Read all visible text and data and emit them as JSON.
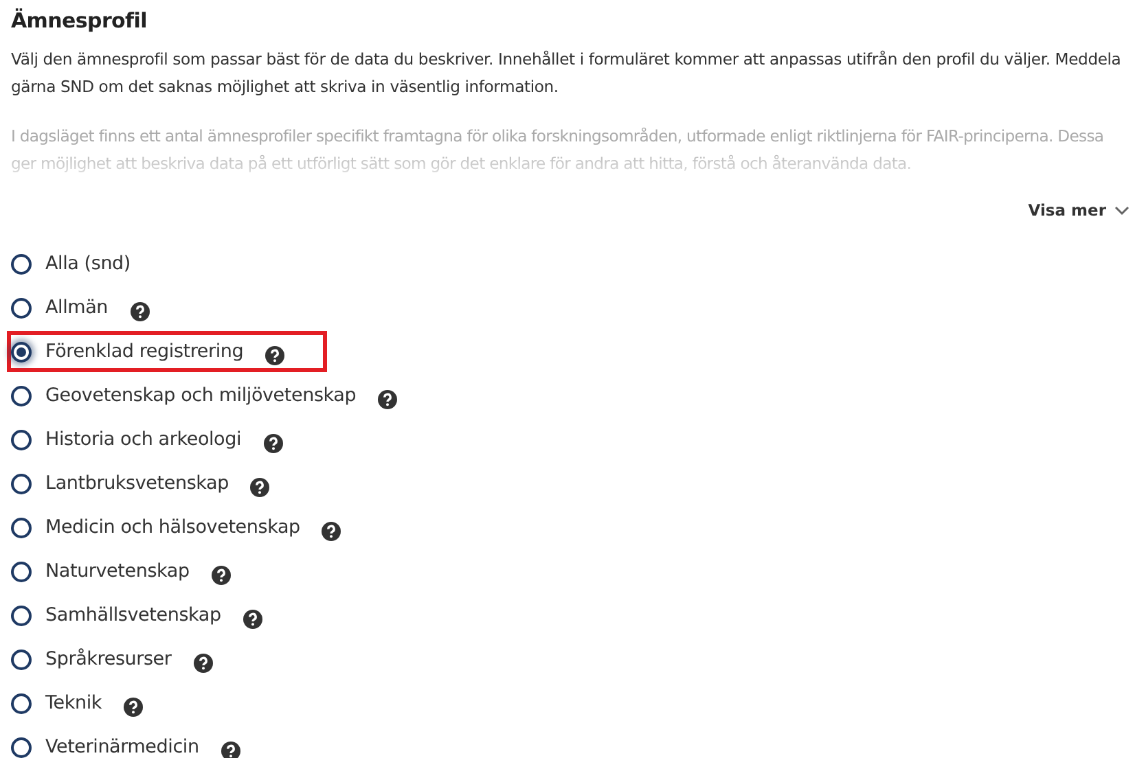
{
  "title": "Ämnesprofil",
  "description": "Välj den ämnesprofil som passar bäst för de data du beskriver. Innehållet i formuläret kommer att anpassas utifrån den profil du väljer. Meddela gärna SND om det saknas möjlighet att skriva in väsentlig information.",
  "more_text": "I dagsläget finns ett antal ämnesprofiler specifikt framtagna för olika forskningsområden, utformade enligt riktlinjerna för FAIR-principerna. Dessa ger möjlighet att beskriva data på ett utförligt sätt som gör det enklare för andra att hitta, förstå och återanvända data.",
  "toggle_label": "Visa mer",
  "options": [
    {
      "label": "Alla (snd)",
      "selected": false,
      "help": false,
      "highlighted": false
    },
    {
      "label": "Allmän",
      "selected": false,
      "help": true,
      "highlighted": false
    },
    {
      "label": "Förenklad registrering",
      "selected": true,
      "help": true,
      "highlighted": true
    },
    {
      "label": "Geovetenskap och miljövetenskap",
      "selected": false,
      "help": true,
      "highlighted": false
    },
    {
      "label": "Historia och arkeologi",
      "selected": false,
      "help": true,
      "highlighted": false
    },
    {
      "label": "Lantbruksvetenskap",
      "selected": false,
      "help": true,
      "highlighted": false
    },
    {
      "label": "Medicin och hälsovetenskap",
      "selected": false,
      "help": true,
      "highlighted": false
    },
    {
      "label": "Naturvetenskap",
      "selected": false,
      "help": true,
      "highlighted": false
    },
    {
      "label": "Samhällsvetenskap",
      "selected": false,
      "help": true,
      "highlighted": false
    },
    {
      "label": "Språkresurser",
      "selected": false,
      "help": true,
      "highlighted": false
    },
    {
      "label": "Teknik",
      "selected": false,
      "help": true,
      "highlighted": false
    },
    {
      "label": "Veterinärmedicin",
      "selected": false,
      "help": true,
      "highlighted": false
    }
  ]
}
